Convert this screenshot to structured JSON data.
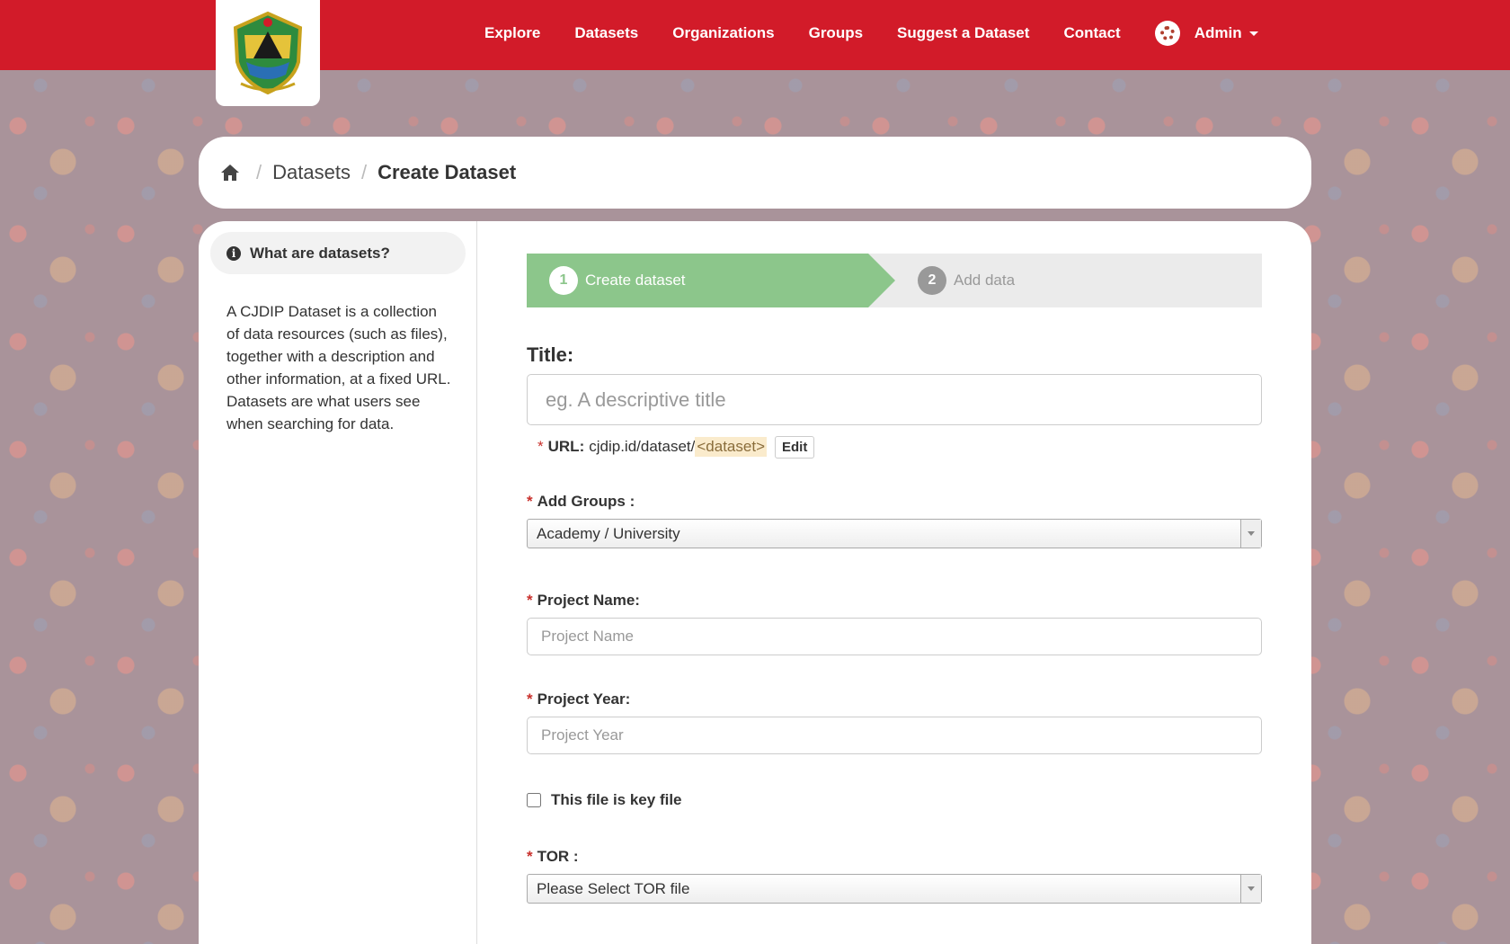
{
  "nav": {
    "items": [
      "Explore",
      "Datasets",
      "Organizations",
      "Groups",
      "Suggest a Dataset",
      "Contact"
    ],
    "user_label": "Admin"
  },
  "breadcrumb": {
    "datasets": "Datasets",
    "current": "Create Dataset"
  },
  "sidebar": {
    "heading": "What are datasets?",
    "text": "A CJDIP Dataset is a collection of data resources (such as files), together with a description and other information, at a fixed URL. Datasets are what users see when searching for data."
  },
  "stages": {
    "step1_number": "1",
    "step1_label": "Create dataset",
    "step2_number": "2",
    "step2_label": "Add data"
  },
  "form": {
    "title_label": "Title:",
    "title_placeholder": "eg. A descriptive title",
    "url_required": "*",
    "url_label": "URL:",
    "url_prefix": "cjdip.id/dataset/",
    "url_slug": "<dataset>",
    "url_edit": "Edit",
    "groups_label": "Add Groups :",
    "groups_value": "Academy / University",
    "project_name_label": "Project Name:",
    "project_name_placeholder": "Project Name",
    "project_year_label": "Project Year:",
    "project_year_placeholder": "Project Year",
    "key_file_label": "This file is key file",
    "tor_label": "TOR :",
    "tor_value": "Please Select TOR file",
    "required_marker": "*"
  },
  "colors": {
    "header": "#d21b29",
    "stage_active": "#8cc68b",
    "stage_inactive": "#ebebeb"
  }
}
